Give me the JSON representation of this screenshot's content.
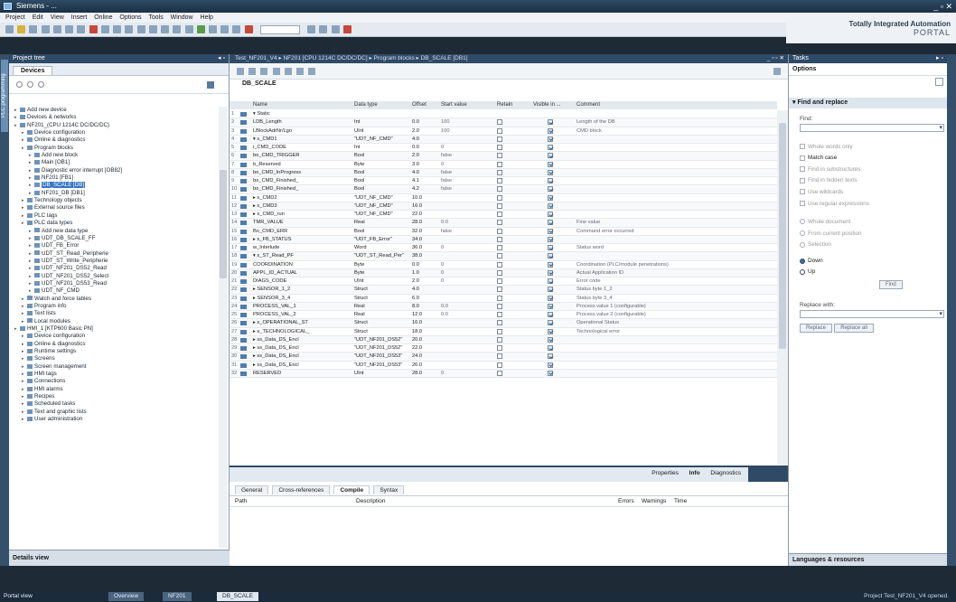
{
  "titlebar": {
    "title": "Siemens - ...",
    "controls": "_ ▫ ✕"
  },
  "menubar": {
    "items": [
      "Project",
      "Edit",
      "View",
      "Insert",
      "Online",
      "Options",
      "Tools",
      "Window",
      "Help"
    ]
  },
  "toolbar": {
    "search_placeholder": ""
  },
  "brand": {
    "line1": "Totally Integrated Automation",
    "line2": "PORTAL"
  },
  "project_tree": {
    "header": "Project tree",
    "tab": "Devices",
    "side_tab": "PLC programming",
    "items": [
      {
        "indent": 0,
        "label": "Add new device"
      },
      {
        "indent": 0,
        "label": "Devices & networks"
      },
      {
        "indent": 0,
        "label": "NF201_(CPU 1214C DC/DC/DC)"
      },
      {
        "indent": 1,
        "label": "Device configuration"
      },
      {
        "indent": 1,
        "label": "Online & diagnostics"
      },
      {
        "indent": 1,
        "label": "Program blocks"
      },
      {
        "indent": 2,
        "label": "Add new block"
      },
      {
        "indent": 2,
        "label": "Main [OB1]"
      },
      {
        "indent": 2,
        "label": "Diagnostic error interrupt [OB82]"
      },
      {
        "indent": 2,
        "label": "NF201 [FB1]"
      },
      {
        "indent": 2,
        "label": "DB_SCALE [DB]",
        "selected": true
      },
      {
        "indent": 2,
        "label": "NF201_DB [DB1]"
      },
      {
        "indent": 1,
        "label": "Technology objects"
      },
      {
        "indent": 1,
        "label": "External source files"
      },
      {
        "indent": 1,
        "label": "PLC tags"
      },
      {
        "indent": 1,
        "label": "PLC data types"
      },
      {
        "indent": 2,
        "label": "Add new data type"
      },
      {
        "indent": 2,
        "label": "UDT_DB_SCALE_FF"
      },
      {
        "indent": 2,
        "label": "UDT_FB_Error"
      },
      {
        "indent": 2,
        "label": "UDT_ST_Read_Peripherie"
      },
      {
        "indent": 2,
        "label": "UDT_ST_Write_Peripherie"
      },
      {
        "indent": 2,
        "label": "UDT_NF201_DS52_Read"
      },
      {
        "indent": 2,
        "label": "UDT_NF201_DS52_Select"
      },
      {
        "indent": 2,
        "label": "UDT_NF201_DS53_Read"
      },
      {
        "indent": 2,
        "label": "UDT_NF_CMD"
      },
      {
        "indent": 1,
        "label": "Watch and force tables"
      },
      {
        "indent": 1,
        "label": "Program info"
      },
      {
        "indent": 1,
        "label": "Text lists"
      },
      {
        "indent": 1,
        "label": "Local modules"
      },
      {
        "indent": 0,
        "label": "HMI_1 [KTP600 Basic PN]"
      },
      {
        "indent": 1,
        "label": "Device configuration"
      },
      {
        "indent": 1,
        "label": "Online & diagnostics"
      },
      {
        "indent": 1,
        "label": "Runtime settings"
      },
      {
        "indent": 1,
        "label": "Screens"
      },
      {
        "indent": 1,
        "label": "Screen management"
      },
      {
        "indent": 1,
        "label": "HMI tags"
      },
      {
        "indent": 1,
        "label": "Connections"
      },
      {
        "indent": 1,
        "label": "HMI alarms"
      },
      {
        "indent": 1,
        "label": "Recipes"
      },
      {
        "indent": 1,
        "label": "Scheduled tasks"
      },
      {
        "indent": 1,
        "label": "Text and graphic lists"
      },
      {
        "indent": 1,
        "label": "User administration"
      }
    ],
    "details_view": "Details view"
  },
  "editor": {
    "title": "Test_NF201_V4 ▸ NF201 [CPU 1214C DC/DC/DC] ▸ Program blocks ▸ DB_SCALE [DB1]",
    "block_name": "DB_SCALE",
    "columns": {
      "name": "Name",
      "type": "Data type",
      "offset": "Offset",
      "start": "Start value",
      "retain": "Retain",
      "visible": "Visible in ...",
      "comment": "Comment"
    },
    "rows": [
      {
        "no": "1",
        "name": "▾ Static",
        "type": "",
        "offset": "",
        "start": "",
        "retain": false,
        "visible": false,
        "comment": ""
      },
      {
        "no": "2",
        "name": "    LDB_Length",
        "type": "Int",
        "offset": "0.0",
        "start": "100",
        "retain": true,
        "visible": true,
        "comment": "Length of the DB"
      },
      {
        "no": "3",
        "name": "    LBlockAdrNr/Lgo",
        "type": "UInt",
        "offset": "2.0",
        "start": "100",
        "retain": true,
        "visible": true,
        "comment": "CMD block"
      },
      {
        "no": "4",
        "name": "  ▾ s_CMD1",
        "type": "\"UDT_NF_CMD\"",
        "offset": "4.0",
        "start": "",
        "retain": true,
        "visible": true,
        "comment": ""
      },
      {
        "no": "5",
        "name": "      i_CMD_CODE",
        "type": "Int",
        "offset": "0.0",
        "start": "0",
        "retain": false,
        "visible": true,
        "comment": ""
      },
      {
        "no": "6",
        "name": "      bo_CMD_TRIGGER",
        "type": "Bool",
        "offset": "2.0",
        "start": "false",
        "retain": false,
        "visible": true,
        "comment": ""
      },
      {
        "no": "7",
        "name": "      b_Reserved",
        "type": "Byte",
        "offset": "3.0",
        "start": "0",
        "retain": false,
        "visible": true,
        "comment": ""
      },
      {
        "no": "8",
        "name": "      bo_CMD_InProgress",
        "type": "Bool",
        "offset": "4.0",
        "start": "false",
        "retain": false,
        "visible": true,
        "comment": ""
      },
      {
        "no": "9",
        "name": "      bo_CMD_Finished_",
        "type": "Bool",
        "offset": "4.1",
        "start": "false",
        "retain": false,
        "visible": true,
        "comment": ""
      },
      {
        "no": "10",
        "name": "      bo_CMD_Finished_",
        "type": "Bool",
        "offset": "4.2",
        "start": "false",
        "retain": false,
        "visible": true,
        "comment": ""
      },
      {
        "no": "11",
        "name": "  ▸ s_CMD2",
        "type": "\"UDT_NF_CMD\"",
        "offset": "10.0",
        "start": "",
        "retain": true,
        "visible": true,
        "comment": ""
      },
      {
        "no": "12",
        "name": "  ▸ s_CMD3",
        "type": "\"UDT_NF_CMD\"",
        "offset": "16.0",
        "start": "",
        "retain": true,
        "visible": true,
        "comment": ""
      },
      {
        "no": "13",
        "name": "  ▸ s_CMD_run",
        "type": "\"UDT_NF_CMD\"",
        "offset": "22.0",
        "start": "",
        "retain": true,
        "visible": true,
        "comment": ""
      },
      {
        "no": "14",
        "name": "    TMR_VALUE",
        "type": "Real",
        "offset": "28.0",
        "start": "0.0",
        "retain": true,
        "visible": true,
        "comment": "Fine value"
      },
      {
        "no": "15",
        "name": "    Bo_CMD_ERR",
        "type": "Bool",
        "offset": "32.0",
        "start": "false",
        "retain": true,
        "visible": true,
        "comment": "Command error occurred"
      },
      {
        "no": "16",
        "name": "  ▸ s_FB_STATUS",
        "type": "\"UDT_FB_Error\"",
        "offset": "34.0",
        "start": "",
        "retain": true,
        "visible": true,
        "comment": ""
      },
      {
        "no": "17",
        "name": "    w_Interlude",
        "type": "Word",
        "offset": "36.0",
        "start": "0",
        "retain": true,
        "visible": true,
        "comment": "Status word"
      },
      {
        "no": "18",
        "name": "  ▾ s_ST_Read_PF",
        "type": "\"UDT_ST_Read_Per\"",
        "offset": "38.0",
        "start": "",
        "retain": true,
        "visible": true,
        "comment": ""
      },
      {
        "no": "19",
        "name": "      COORDINATION",
        "type": "Byte",
        "offset": "0.0",
        "start": "0",
        "retain": false,
        "visible": true,
        "comment": "Coordination (PLC/module penetrations)"
      },
      {
        "no": "20",
        "name": "      APPL_ID_ACTUAL",
        "type": "Byte",
        "offset": "1.0",
        "start": "0",
        "retain": false,
        "visible": true,
        "comment": "Actual Application ID"
      },
      {
        "no": "21",
        "name": "      DIAGS_CODE",
        "type": "UInt",
        "offset": "2.0",
        "start": "0",
        "retain": false,
        "visible": true,
        "comment": "Error code"
      },
      {
        "no": "22",
        "name": "    ▸ SENSOR_1_2",
        "type": "Struct",
        "offset": "4.0",
        "start": "",
        "retain": false,
        "visible": true,
        "comment": "Status byte 1_2"
      },
      {
        "no": "23",
        "name": "    ▸ SENSOR_3_4",
        "type": "Struct",
        "offset": "6.0",
        "start": "",
        "retain": false,
        "visible": true,
        "comment": "Status byte 3_4"
      },
      {
        "no": "24",
        "name": "      PROCESS_VAL_1",
        "type": "Real",
        "offset": "8.0",
        "start": "0.0",
        "retain": false,
        "visible": true,
        "comment": "Process value 1 (configurable)"
      },
      {
        "no": "25",
        "name": "      PROCESS_VAL_2",
        "type": "Real",
        "offset": "12.0",
        "start": "0.0",
        "retain": false,
        "visible": true,
        "comment": "Process value 2 (configurable)"
      },
      {
        "no": "26",
        "name": "    ▸ s_OPERATIONAL_ST",
        "type": "Struct",
        "offset": "16.0",
        "start": "",
        "retain": false,
        "visible": true,
        "comment": "Operational Status"
      },
      {
        "no": "27",
        "name": "    ▸ s_TECHNOLOGICAL_",
        "type": "Struct",
        "offset": "18.0",
        "start": "",
        "retain": false,
        "visible": true,
        "comment": "Technological error"
      },
      {
        "no": "28",
        "name": "    ▸ ss_Data_DS_Encl",
        "type": "\"UDT_NF201_DS52\"",
        "offset": "20.0",
        "start": "",
        "retain": false,
        "visible": true,
        "comment": ""
      },
      {
        "no": "29",
        "name": "    ▸ ss_Data_DS_Encl",
        "type": "\"UDT_NF201_DS52\"",
        "offset": "22.0",
        "start": "",
        "retain": false,
        "visible": true,
        "comment": ""
      },
      {
        "no": "30",
        "name": "    ▸ ss_Data_DS_Encl",
        "type": "\"UDT_NF201_DS53\"",
        "offset": "24.0",
        "start": "",
        "retain": false,
        "visible": true,
        "comment": ""
      },
      {
        "no": "31",
        "name": "    ▸ ss_Data_DS_Encl",
        "type": "\"UDT_NF201_DS53\"",
        "offset": "26.0",
        "start": "",
        "retain": false,
        "visible": true,
        "comment": ""
      },
      {
        "no": "32",
        "name": "    RESERVED",
        "type": "UInt",
        "offset": "28.0",
        "start": "0",
        "retain": false,
        "visible": true,
        "comment": ""
      }
    ]
  },
  "inspector": {
    "panel_tabs": [
      "Properties",
      "Info",
      "Diagnostics"
    ],
    "active_panel_tab": "Info",
    "sub_tabs": [
      "General",
      "Cross-references",
      "Compile",
      "Syntax"
    ],
    "active_sub_tab": "Compile",
    "columns": [
      "Path",
      "Description",
      "Errors",
      "Warnings",
      "Time"
    ]
  },
  "tasks": {
    "header": "Tasks",
    "options": "Options",
    "section": "Find and replace",
    "find_label": "Find:",
    "checks": [
      "Whole words only",
      "Match case",
      "Find in substructures",
      "Find in hidden texts",
      "Use wildcards",
      "Use regular expressions"
    ],
    "scope_options": [
      "Whole document",
      "From current position",
      "Selection"
    ],
    "direction_options": [
      "Down",
      "Up"
    ],
    "find_button": "Find",
    "replace_label": "Replace with:",
    "replace_button": "Replace",
    "replace_all_button": "Replace all",
    "languages": "Languages & resources"
  },
  "portal_bar": {
    "portal_view": "Portal view",
    "open_tabs": [
      "Overview",
      "NF201",
      "DB_SCALE"
    ],
    "active_tab": "DB_SCALE",
    "status": "Project Test_NF201_V4 opened."
  }
}
